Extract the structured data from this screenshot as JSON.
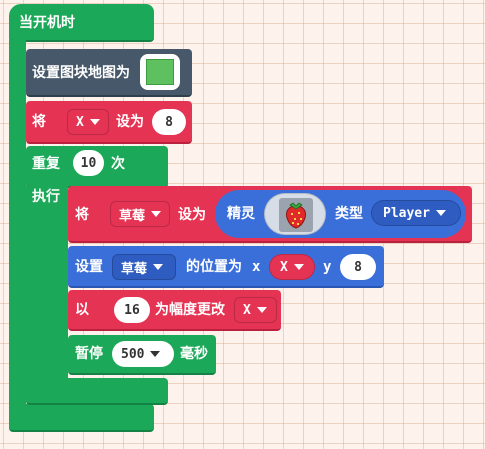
{
  "hat": {
    "label": "当开机时"
  },
  "set_tilemap": {
    "label": "设置图块地图为",
    "thumb_color": "#5fc05f"
  },
  "set_var": {
    "prefix": "将",
    "var": "X",
    "mid": "设为",
    "value": "8"
  },
  "repeat": {
    "label": "重复",
    "count": "10",
    "suffix": "次",
    "do_label": "执行"
  },
  "set_sprite": {
    "prefix": "将",
    "var": "草莓",
    "mid": "设为",
    "sprite_label": "精灵",
    "kind_label": "类型",
    "kind": "Player",
    "sprite_icon": "strawberry-sprite-icon"
  },
  "set_position": {
    "prefix": "设置",
    "sprite": "草莓",
    "mid": "的位置为",
    "x_label": "x",
    "x_value": "X",
    "y_label": "y",
    "y_value": "8"
  },
  "change_var": {
    "prefix": "以",
    "amount": "16",
    "mid": "为幅度更改",
    "var": "X"
  },
  "pause": {
    "prefix": "暂停",
    "value": "500",
    "suffix": "毫秒"
  },
  "colors": {
    "loops": "#1ba858",
    "scene": "#465869",
    "variables": "#e53353",
    "sprites": "#3a6fd9",
    "workspace": "#fdf3ec"
  }
}
